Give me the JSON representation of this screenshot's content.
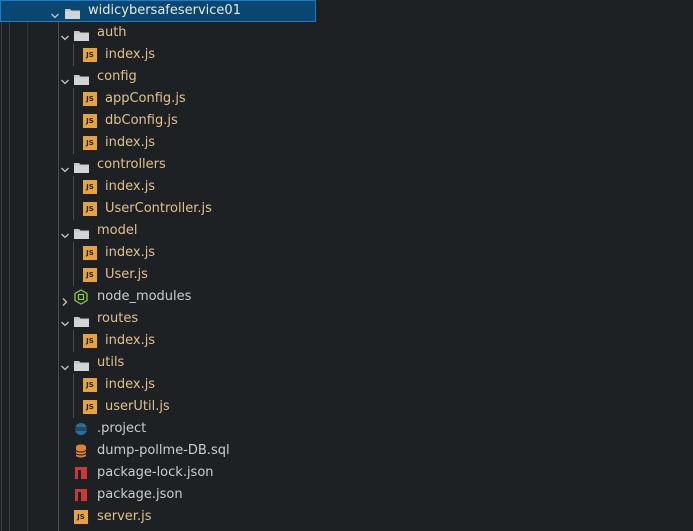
{
  "explorer": {
    "root": {
      "label": "widicybersafeservice01",
      "expanded": true
    },
    "folders": [
      {
        "label": "auth",
        "expanded": true,
        "files": [
          {
            "label": "index.js",
            "icon": "js-file-icon"
          }
        ]
      },
      {
        "label": "config",
        "expanded": true,
        "files": [
          {
            "label": "appConfig.js",
            "icon": "js-file-icon"
          },
          {
            "label": "dbConfig.js",
            "icon": "js-file-icon"
          },
          {
            "label": "index.js",
            "icon": "js-file-icon"
          }
        ]
      },
      {
        "label": "controllers",
        "expanded": true,
        "files": [
          {
            "label": "index.js",
            "icon": "js-file-icon"
          },
          {
            "label": "UserController.js",
            "icon": "js-file-icon"
          }
        ]
      },
      {
        "label": "model",
        "expanded": true,
        "files": [
          {
            "label": "index.js",
            "icon": "js-file-icon"
          },
          {
            "label": "User.js",
            "icon": "js-file-icon"
          }
        ]
      },
      {
        "label": "node_modules",
        "expanded": false,
        "files": []
      },
      {
        "label": "routes",
        "expanded": true,
        "files": [
          {
            "label": "index.js",
            "icon": "js-file-icon"
          }
        ]
      },
      {
        "label": "utils",
        "expanded": true,
        "files": [
          {
            "label": "index.js",
            "icon": "js-file-icon"
          },
          {
            "label": "userUtil.js",
            "icon": "js-file-icon"
          }
        ]
      }
    ],
    "root_files": [
      {
        "label": ".project",
        "icon": "eclipse-project-icon"
      },
      {
        "label": "dump-pollme-DB.sql",
        "icon": "database-icon"
      },
      {
        "label": "package-lock.json",
        "icon": "npm-icon"
      },
      {
        "label": "package.json",
        "icon": "npm-icon"
      },
      {
        "label": "server.js",
        "icon": "js-file-icon"
      }
    ],
    "js_badge_text": "JS"
  },
  "colors": {
    "background": "#1e2124",
    "selection": "#094771",
    "selection_border": "#1d7cc9",
    "modified_text": "#e2c08d",
    "default_text": "#cccccc",
    "js_badge": "#e8a33d",
    "npm_red": "#cb3837",
    "db_orange": "#e0803a",
    "eclipse_blue": "#2c6ea0"
  }
}
